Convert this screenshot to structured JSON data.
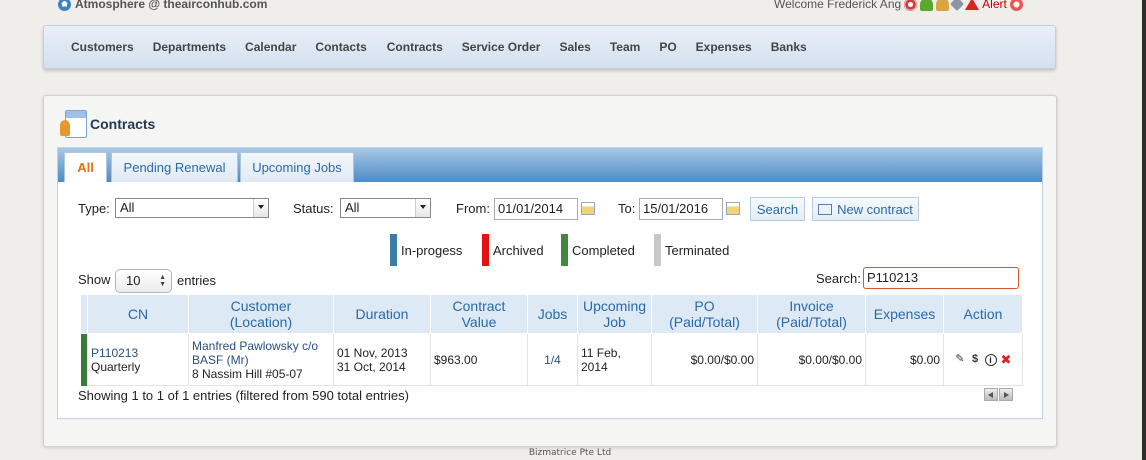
{
  "header": {
    "site_name": "Atmosphere @ theairconhub.com",
    "welcome": "Welcome Frederick Ang",
    "alert_label": "Alert"
  },
  "nav": {
    "items": [
      "Customers",
      "Departments",
      "Calendar",
      "Contacts",
      "Contracts",
      "Service Order",
      "Sales",
      "Team",
      "PO",
      "Expenses",
      "Banks"
    ]
  },
  "page": {
    "title": "Contracts"
  },
  "tabs": [
    "All",
    "Pending Renewal",
    "Upcoming Jobs"
  ],
  "filters": {
    "type_label": "Type:",
    "type_value": "All",
    "status_label": "Status:",
    "status_value": "All",
    "from_label": "From:",
    "from_value": "01/01/2014",
    "to_label": "To:",
    "to_value": "15/01/2016",
    "search_button": "Search",
    "new_contract_button": "New contract"
  },
  "legend": [
    {
      "label": "In-progess",
      "color": "#3a7ca5"
    },
    {
      "label": "Archived",
      "color": "#e31313"
    },
    {
      "label": "Completed",
      "color": "#3f8a3f"
    },
    {
      "label": "Terminated",
      "color": "#c8c8c8"
    }
  ],
  "table_controls": {
    "show_label": "Show",
    "page_length": "10",
    "entries_label": "entries",
    "search_label": "Search:",
    "search_value": "P110213"
  },
  "table": {
    "columns": [
      "CN",
      "Customer (Location)",
      "Duration",
      "Contract Value",
      "Jobs",
      "Upcoming Job",
      "PO (Paid/Total)",
      "Invoice (Paid/Total)",
      "Expenses",
      "Action"
    ],
    "rows": [
      {
        "status_color": "#3a7b3a",
        "cn": "P110213",
        "cn_type": "Quarterly",
        "customer": "Manfred Pawlowsky c/o BASF (Mr)",
        "location": "8 Nassim Hill #05-07",
        "duration_start": "01 Nov, 2013",
        "duration_end": "31 Oct, 2014",
        "contract_value": "$963.00",
        "jobs": "1/4",
        "upcoming_job": "11 Feb, 2014",
        "po": "$0.00/$0.00",
        "invoice": "$0.00/$0.00",
        "expenses": "$0.00"
      }
    ]
  },
  "table_info": "Showing 1 to 1 of 1 entries (filtered from 590 total entries)",
  "footer": "Bizmatrice Pte Ltd"
}
